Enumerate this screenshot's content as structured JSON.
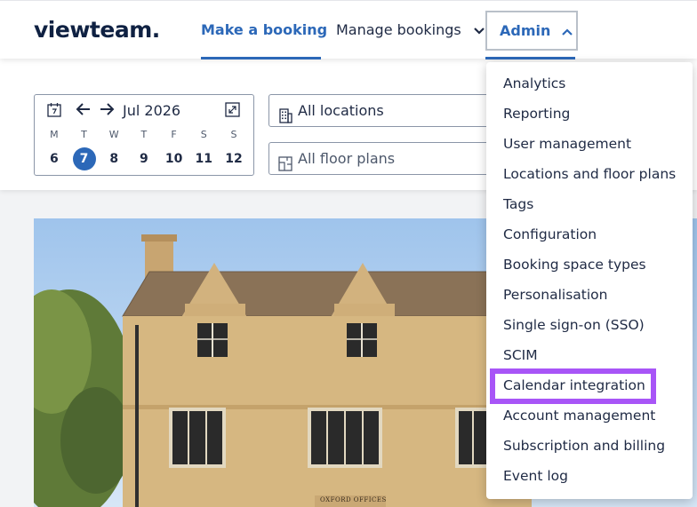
{
  "header": {
    "logo": "viewteam.",
    "nav": {
      "make_booking": "Make a booking",
      "manage_bookings": "Manage bookings",
      "admin": "Admin"
    }
  },
  "filters": {
    "month": "Jul 2026",
    "weekdays": [
      "M",
      "T",
      "W",
      "T",
      "F",
      "S",
      "S"
    ],
    "days": [
      "6",
      "7",
      "8",
      "9",
      "10",
      "11",
      "12"
    ],
    "selected_day": "7",
    "locations": "All locations",
    "floor_plans": "All floor plans"
  },
  "admin_menu": {
    "items": [
      "Analytics",
      "Reporting",
      "User management",
      "Locations and floor plans",
      "Tags",
      "Configuration",
      "Booking space types",
      "Personalisation",
      "Single sign-on (SSO)",
      "SCIM",
      "Calendar integration",
      "Account management",
      "Subscription and billing",
      "Event log"
    ],
    "highlighted": "Calendar integration"
  },
  "hero": {
    "sign_text": "OXFORD OFFICES"
  },
  "colors": {
    "brand_blue": "#2c68b8",
    "logo_navy": "#0f2142",
    "highlight_purple": "#a855f7"
  }
}
